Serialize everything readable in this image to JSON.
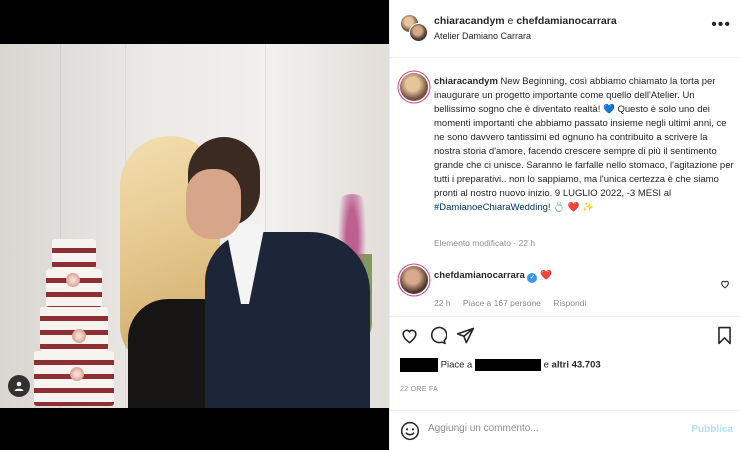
{
  "post": {
    "author_primary": "chiaracandym",
    "connector": " e ",
    "author_secondary": "chefdamianocarrara",
    "location": "Atelier Damiano Carrara"
  },
  "caption": {
    "username": "chiaracandym",
    "text_1": " New Beginning, così abbiamo chiamato la torta per inaugurare un progetto importante come quello dell'Atelier. Un bellissimo sogno che è diventato realtà! ",
    "heart_blue": "💙",
    "text_2": " Questo è solo uno dei momenti importanti che abbiamo passato insieme negli ultimi anni, ce ne sono davvero tantissimi ed ognuno ha contribuito a scrivere la nostra storia d'amore, facendo crescere sempre di più il sentimento grande che ci unisce. Saranno le farfalle nello stomaco, l'agitazione per tutti i preparativi.. non lo sappiamo, ma l'unica certezza è che siamo pronti al nostro nuovo inizio. 9 LUGLIO 2022, -3 MESI al ",
    "hashtag": "#DamianoeChiaraWedding!",
    "emojis": " 💍 ❤️ ✨",
    "meta": "Elemento modificato · 22 h"
  },
  "comment": {
    "username": "chefdamianocarrara",
    "verified_mark": "✓",
    "text": "❤️",
    "time": "22 h",
    "likes": "Piace a 167 persone",
    "reply": "Rispondi"
  },
  "likes": {
    "prefix": "Piace a ",
    "connector": " e ",
    "others": "altri 43.703"
  },
  "time_ago": "22 ORE FA",
  "comment_box": {
    "placeholder": "Aggiungi un commento...",
    "publish": "Pubblica"
  },
  "icons": {
    "more": "more-options-icon",
    "like": "heart-icon",
    "comment": "comment-icon",
    "share": "share-icon",
    "save": "bookmark-icon",
    "emoji": "emoji-icon",
    "tagged_users": "user-tag-icon"
  }
}
